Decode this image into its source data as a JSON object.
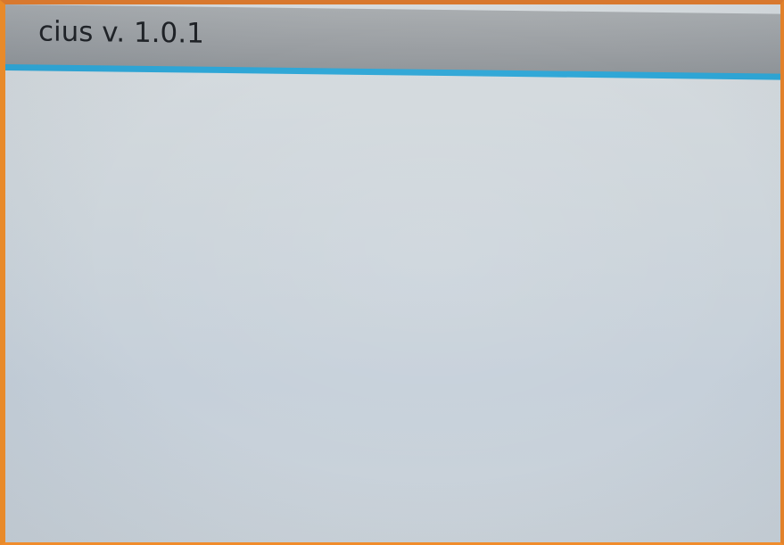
{
  "window": {
    "title": "cius v. 1.0.1"
  },
  "colors": {
    "accent": "#2ea6d6",
    "titlebar": "#9a9ea2",
    "background": "#cbd3da",
    "bezel": "#e88a2a"
  }
}
